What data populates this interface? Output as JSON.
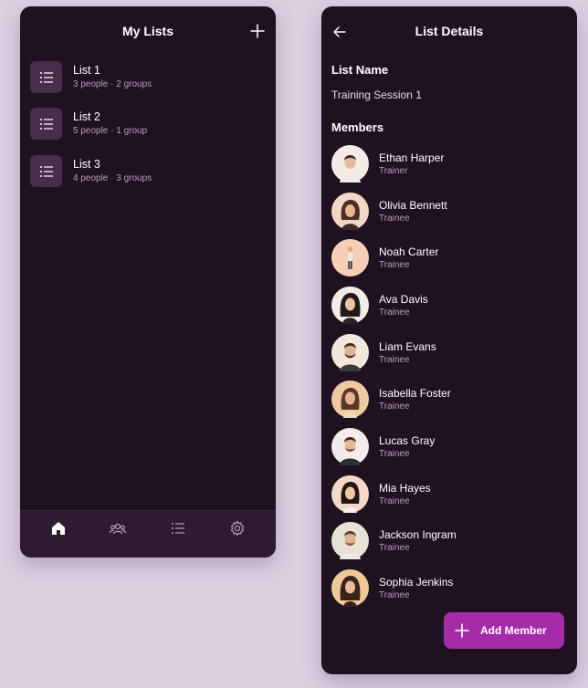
{
  "my_lists": {
    "title": "My Lists",
    "add_icon": "plus-icon",
    "items": [
      {
        "title": "List 1",
        "subtitle": "3 people · 2 groups",
        "icon": "list-icon"
      },
      {
        "title": "List 2",
        "subtitle": "5 people · 1 group",
        "icon": "list-icon"
      },
      {
        "title": "List 3",
        "subtitle": "4 people · 3 groups",
        "icon": "list-icon"
      }
    ],
    "nav": [
      {
        "icon": "home-icon",
        "active": true
      },
      {
        "icon": "people-icon",
        "active": false
      },
      {
        "icon": "list-icon",
        "active": false
      },
      {
        "icon": "gear-icon",
        "active": false
      }
    ]
  },
  "details": {
    "title": "List Details",
    "back_icon": "back-arrow-icon",
    "list_name_label": "List Name",
    "list_name_value": "Training Session 1",
    "members_label": "Members",
    "members": [
      {
        "name": "Ethan Harper",
        "role": "Trainer"
      },
      {
        "name": "Olivia Bennett",
        "role": "Trainee"
      },
      {
        "name": "Noah Carter",
        "role": "Trainee"
      },
      {
        "name": "Ava Davis",
        "role": "Trainee"
      },
      {
        "name": "Liam Evans",
        "role": "Trainee"
      },
      {
        "name": "Isabella Foster",
        "role": "Trainee"
      },
      {
        "name": "Lucas Gray",
        "role": "Trainee"
      },
      {
        "name": "Mia Hayes",
        "role": "Trainee"
      },
      {
        "name": "Jackson Ingram",
        "role": "Trainee"
      },
      {
        "name": "Sophia Jenkins",
        "role": "Trainee"
      }
    ],
    "add_member_label": "Add Member"
  },
  "colors": {
    "page_bg": "#dccfe0",
    "panel_bg": "#1f1220",
    "accent": "#a62ba9",
    "muted_text": "#b99ebd"
  }
}
